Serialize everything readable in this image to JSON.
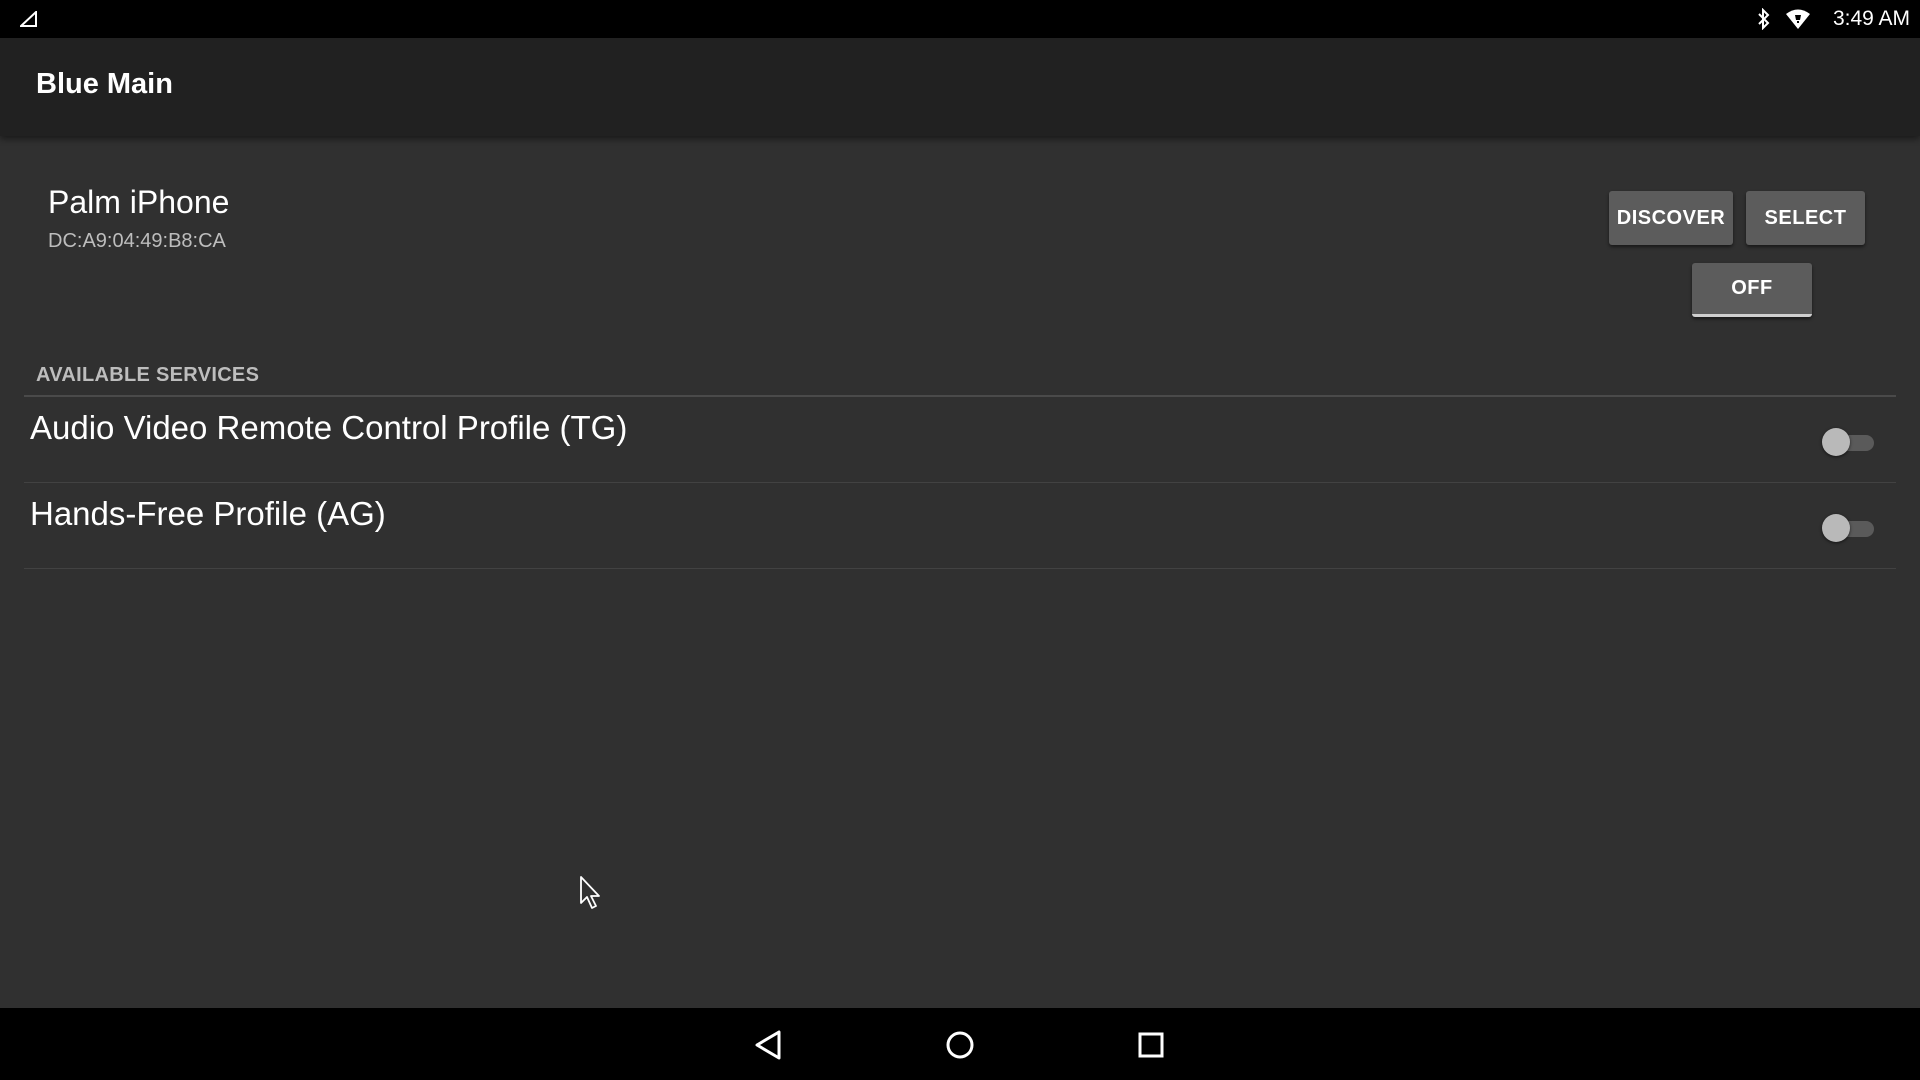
{
  "status_bar": {
    "time": "3:49 AM",
    "icons": [
      "signal-icon",
      "bluetooth-icon",
      "wifi-icon"
    ]
  },
  "app_bar": {
    "title": "Blue Main"
  },
  "device": {
    "name": "Palm iPhone",
    "address": "DC:A9:04:49:B8:CA"
  },
  "buttons": {
    "discover": "DISCOVER",
    "select": "SELECT",
    "off": "OFF"
  },
  "services": {
    "header": "AVAILABLE SERVICES",
    "items": [
      {
        "label": "Audio Video Remote Control Profile (TG)",
        "enabled": false
      },
      {
        "label": "Hands-Free Profile (AG)",
        "enabled": false
      }
    ]
  },
  "nav_bar": {
    "icons": [
      "back-icon",
      "home-icon",
      "recents-icon"
    ]
  },
  "colors": {
    "background": "#303030",
    "app_bar": "#212121",
    "button": "#5c5c5c",
    "system_bars": "#000000"
  }
}
